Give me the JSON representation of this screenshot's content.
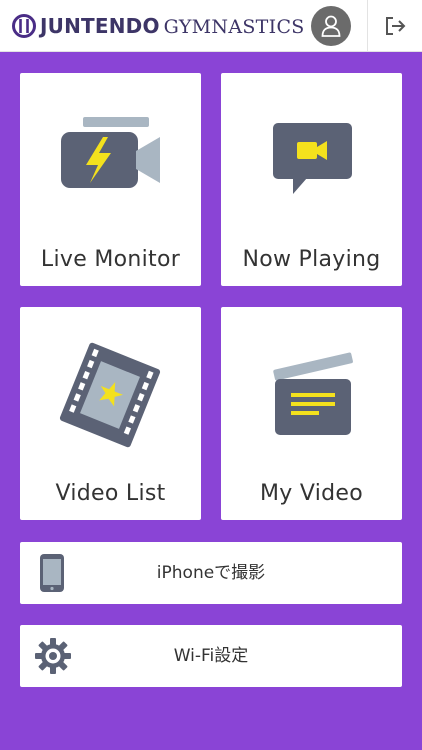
{
  "header": {
    "brand_primary": "JUNTENDO",
    "brand_secondary": "GYMNASTICS",
    "icons": {
      "logo": "logo-mark-icon",
      "account": "person-icon",
      "logout": "logout-icon"
    }
  },
  "tiles": [
    {
      "label": "Live Monitor",
      "icon": "video-camera-lightning-icon"
    },
    {
      "label": "Now Playing",
      "icon": "video-chat-bubble-icon"
    },
    {
      "label": "Video List",
      "icon": "film-strip-star-icon"
    },
    {
      "label": "My Video",
      "icon": "clapperboard-icon"
    }
  ],
  "actions": [
    {
      "label": "iPhoneで撮影",
      "icon": "smartphone-icon"
    },
    {
      "label": "Wi-Fi設定",
      "icon": "gear-icon"
    }
  ],
  "colors": {
    "background": "#8a44d6",
    "brand": "#3d3567",
    "icon_slate": "#5b6275",
    "icon_light": "#a9b6c2",
    "accent_yellow": "#f4e11d"
  }
}
